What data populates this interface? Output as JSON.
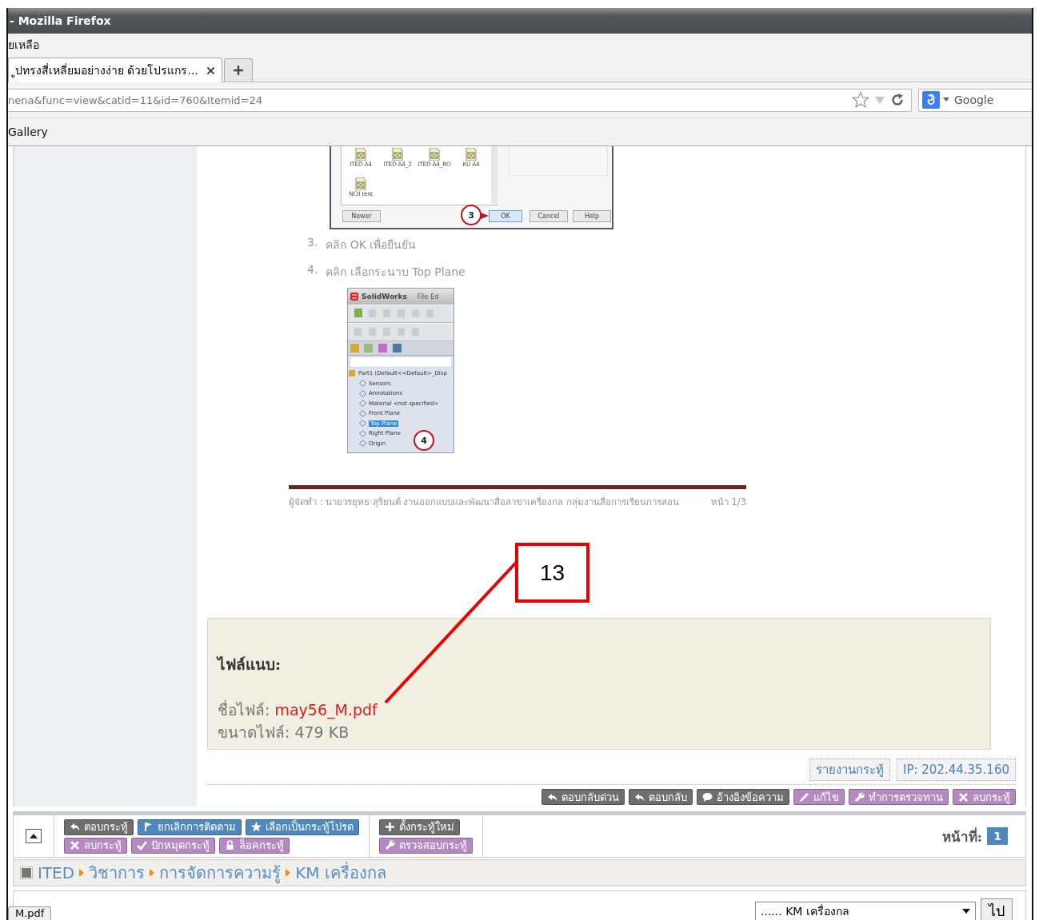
{
  "window": {
    "title": "- Mozilla Firefox"
  },
  "menu_bar": {
    "item": "ยเหลือ"
  },
  "tabs": [
    {
      "label": "ูปทรงสี่เหลี่ยมอย่างง่าย ด้วยโปรแกร...",
      "selected": true
    }
  ],
  "address_bar": {
    "url": "nena&func=view&catid=11&id=760&Itemid=24"
  },
  "search_bar": {
    "placeholder": "Google"
  },
  "bookmarks_bar": {
    "items": [
      "Gallery"
    ]
  },
  "document": {
    "dialog": {
      "templates": [
        "ITED A4",
        "ITED A4_2",
        "ITED A4_RO",
        "KU A4",
        "NCII test"
      ],
      "buttons": [
        {
          "label": "Newer",
          "kind": "plain"
        },
        {
          "label": "OK",
          "kind": "default"
        },
        {
          "label": "Cancel",
          "kind": "plain"
        },
        {
          "label": "Help",
          "kind": "plain"
        }
      ],
      "marker": "3"
    },
    "steps": [
      {
        "number": "3.",
        "text": "คลิก OK เพื่อยืนยัน"
      },
      {
        "number": "4.",
        "text": "คลิก เลือกระนาบ Top Plane"
      }
    ],
    "solidworks": {
      "title": "SolidWorks",
      "menu": [
        "File",
        "Ed"
      ],
      "root": "Part1  (Default<<Default>_Disp",
      "tree": [
        {
          "label": "Sensors",
          "selected": false
        },
        {
          "label": "Annotations",
          "selected": false
        },
        {
          "label": "Material <not specified>",
          "selected": false
        },
        {
          "label": "Front Plane",
          "selected": false
        },
        {
          "label": "Top Plane",
          "selected": true
        },
        {
          "label": "Right Plane",
          "selected": false
        },
        {
          "label": "Origin",
          "selected": false
        }
      ],
      "marker": "4"
    },
    "footer": "ผู้จัดทำ : นายวรยุทธ สุริยนต์ งานออกแบบและพัฒนาสื่อสาขาเครื่องกล กลุ่มงานสื่อการเรียนการสอน",
    "page": "หน้า 1/3"
  },
  "callout": {
    "label": "13"
  },
  "attachment": {
    "heading": "ไฟล์แนบ:",
    "name_label": "ชื่อไฟล์:",
    "file_name": "may56_M.pdf",
    "size_label": "ขนาดไฟล์:",
    "size": "479 KB"
  },
  "post_info": [
    "รายงานกระทู้",
    "IP: 202.44.35.160"
  ],
  "post_actions": [
    {
      "label": "ตอบกลับด่วน",
      "kind": "dark"
    },
    {
      "label": "ตอบกลับ",
      "kind": "dark"
    },
    {
      "label": "อ้างอิงข้อความ",
      "kind": "dark"
    },
    {
      "label": "แก้ไข",
      "kind": "purple"
    },
    {
      "label": "ทำการตรวจทาน",
      "kind": "purple"
    },
    {
      "label": "ลบกระทู้",
      "kind": "purple"
    }
  ],
  "thread_tools": {
    "groups": [
      [
        [
          {
            "label": "ตอบกระทู้",
            "kind": "dark"
          },
          {
            "label": "ยกเลิกการติดตาม",
            "kind": "blue"
          },
          {
            "label": "เลือกเป็นกระทู้โปรด",
            "kind": "blue"
          }
        ],
        [
          {
            "label": "ลบกระทู้",
            "kind": "purple"
          },
          {
            "label": "ปักหมุดกระทู้",
            "kind": "purple"
          },
          {
            "label": "ล็อคกระทู้",
            "kind": "purple"
          }
        ]
      ],
      [
        [
          {
            "label": "ตั้งกระทู้ใหม่",
            "kind": "dark"
          }
        ],
        [
          {
            "label": "ตรวจสอบกระทู้",
            "kind": "purple"
          }
        ]
      ]
    ]
  },
  "pagination": {
    "label": "หน้าที่:",
    "pages": [
      {
        "label": "1",
        "selected": true
      }
    ]
  },
  "breadcrumb": [
    "ITED",
    "วิชาการ",
    "การจัดการความรู้",
    "KM เครื่องกล"
  ],
  "jump": {
    "value": "...... KM เครื่องกล",
    "button": "ไป"
  },
  "download_tab": {
    "label": "M.pdf"
  }
}
